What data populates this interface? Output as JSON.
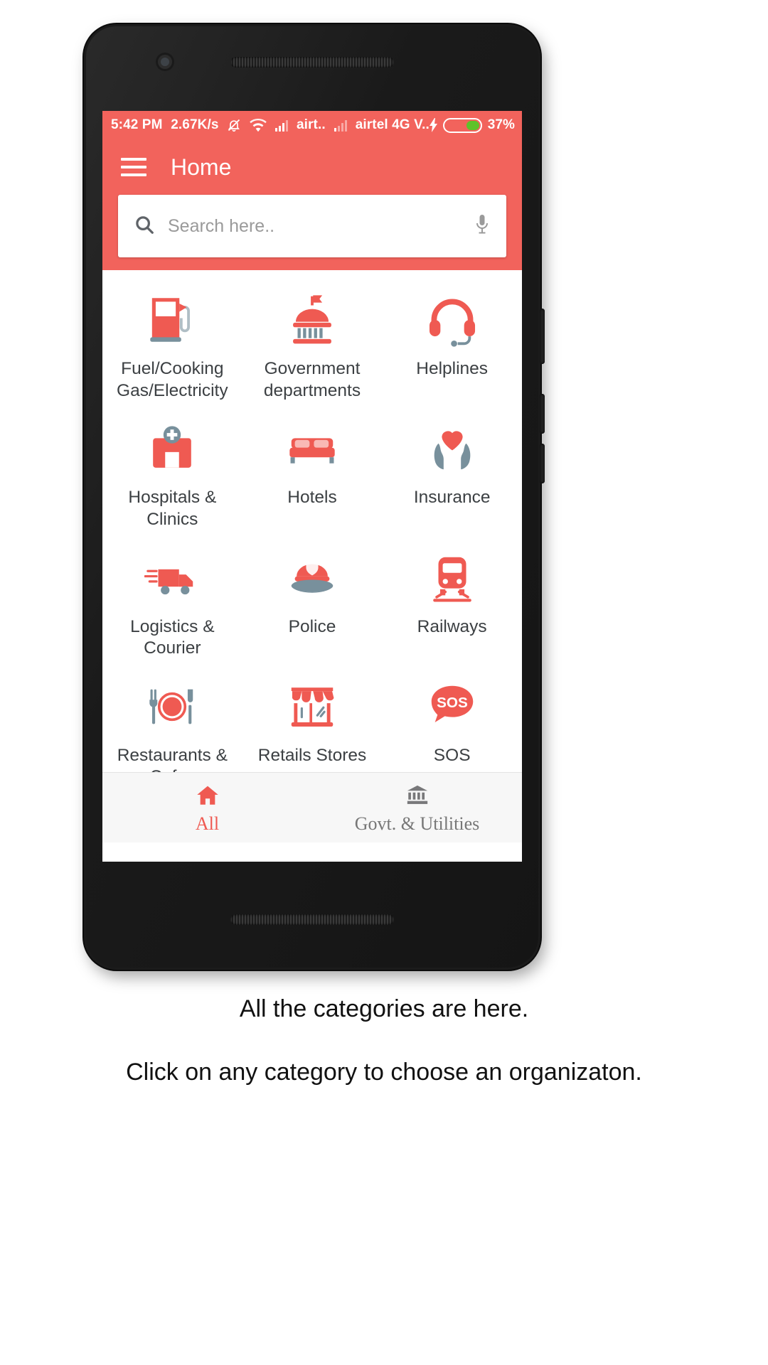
{
  "theme": {
    "primary": "#f2635c",
    "accent": "#ef5a52",
    "icon_red": "#ef5a52",
    "icon_gray": "#78909c",
    "battery_green": "#5ec22a",
    "screen_bg": "#ffffff",
    "tabbar_bg": "#f7f7f7"
  },
  "status_bar": {
    "time": "5:42 PM",
    "net_speed": "2.67K/s",
    "icons": [
      "mute-bell-icon",
      "wifi-icon",
      "signal-icon"
    ],
    "carrier_1": "airt..",
    "carrier_2": "airtel 4G V..",
    "charging_icon": "bolt-icon",
    "battery_percent": "37%",
    "battery_level": 37
  },
  "app_bar": {
    "menu_icon": "hamburger-icon",
    "title": "Home"
  },
  "search": {
    "icon": "search-icon",
    "placeholder": "Search here..",
    "value": "",
    "voice_icon": "microphone-icon"
  },
  "grid": {
    "rows": [
      [
        {
          "icon": "fuel-pump-icon",
          "label": "Fuel/Cooking Gas/Electricity"
        },
        {
          "icon": "government-building-icon",
          "label": "Government departments"
        },
        {
          "icon": "headset-icon",
          "label": "Helplines"
        }
      ],
      [
        {
          "icon": "hospital-icon",
          "label": "Hospitals & Clinics"
        },
        {
          "icon": "bed-icon",
          "label": "Hotels"
        },
        {
          "icon": "heart-in-hands-icon",
          "label": "Insurance"
        }
      ],
      [
        {
          "icon": "delivery-truck-icon",
          "label": "Logistics & Courier"
        },
        {
          "icon": "police-cap-icon",
          "label": "Police"
        },
        {
          "icon": "train-icon",
          "label": "Railways"
        }
      ],
      [
        {
          "icon": "cutlery-plate-icon",
          "label": "Restaurants & Cafes"
        },
        {
          "icon": "store-front-icon",
          "label": "Retails Stores"
        },
        {
          "icon": "sos-icon",
          "label": "SOS"
        }
      ],
      [
        {
          "icon": "taxi-icon",
          "label": ""
        },
        {
          "icon": "mobile-phone-icon",
          "label": ""
        },
        {
          "icon": "suitcase-icon",
          "label": ""
        }
      ]
    ]
  },
  "bottom_tabs": [
    {
      "icon": "home-icon",
      "label": "All",
      "active": true
    },
    {
      "icon": "bank-icon",
      "label": "Govt. & Utilities",
      "active": false
    }
  ],
  "captions": {
    "line1": "All the categories are here.",
    "line2": "Click on any category to choose an organizaton."
  }
}
